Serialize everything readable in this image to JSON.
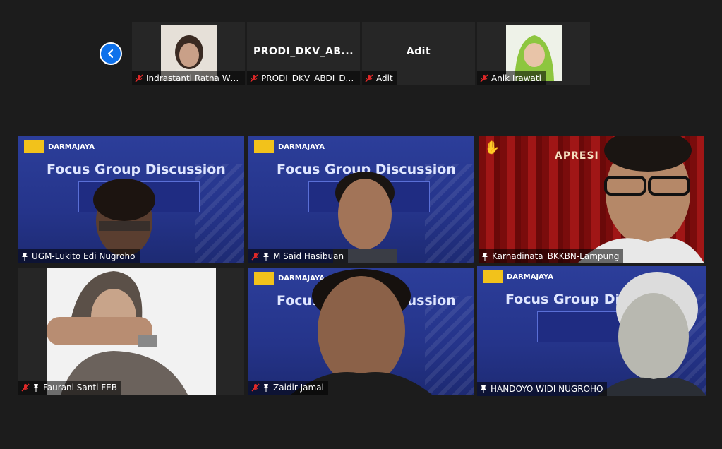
{
  "navigation": {
    "prev_icon": "chevron-left-icon"
  },
  "thumbnails": [
    {
      "name": "Indrastanti Ratna Wid...",
      "muted": true,
      "has_video": true
    },
    {
      "name": "PRODI_DKV_ABDI_DA...",
      "display": "PRODI_DKV_AB...",
      "muted": true,
      "has_video": false
    },
    {
      "name": "Adit",
      "display": "Adit",
      "muted": true,
      "has_video": false
    },
    {
      "name": "Anik Irawati",
      "muted": true,
      "has_video": true
    }
  ],
  "gallery": [
    {
      "name": "UGM-Lukito Edi Nugroho",
      "muted": false,
      "pinned": true,
      "background": "slide"
    },
    {
      "name": "M Said Hasibuan",
      "muted": true,
      "pinned": true,
      "background": "slide"
    },
    {
      "name": "Karnadinata_BKKBN-Lampung",
      "muted": false,
      "pinned": true,
      "background": "stage",
      "raised_hand": true
    },
    {
      "name": "Faurani Santi FEB",
      "muted": true,
      "pinned": true,
      "background": "white"
    },
    {
      "name": "Zaidir Jamal",
      "muted": true,
      "pinned": true,
      "background": "slide"
    },
    {
      "name": "HANDOYO WIDI NUGROHO",
      "muted": false,
      "pinned": true,
      "background": "slide",
      "active_speaker": true
    }
  ],
  "slide": {
    "brand": "DARMAJAYA",
    "title": "Focus Group Discussion"
  },
  "stage_text": "APRESI",
  "colors": {
    "active_border": "#d5e85c",
    "muted_icon": "#e02828",
    "accent": "#0e71eb"
  }
}
